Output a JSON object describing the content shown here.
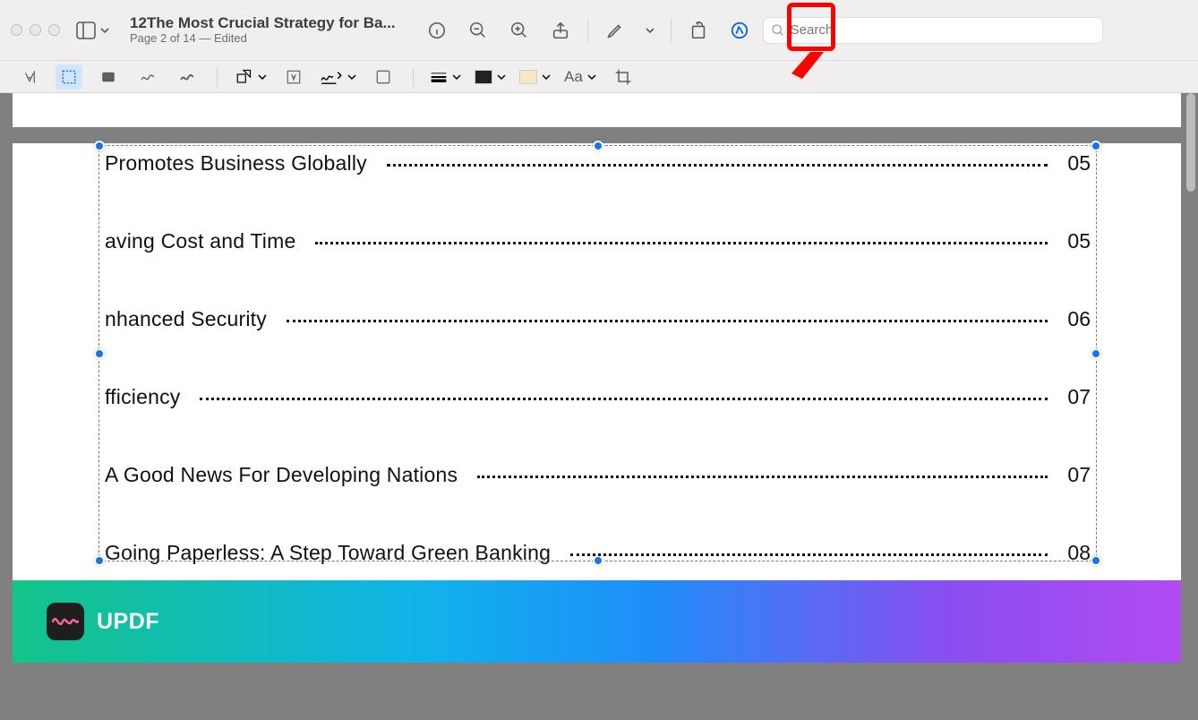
{
  "header": {
    "title": "12The Most Crucial Strategy for Ba...",
    "page_status": "Page 2 of 14 — Edited",
    "search_placeholder": "Search"
  },
  "toc": [
    {
      "title": "Promotes Business Globally",
      "page": "05"
    },
    {
      "title": "aving Cost and Time",
      "page": "05"
    },
    {
      "title": "nhanced Security",
      "page": "06"
    },
    {
      "title": "fficiency",
      "page": "07"
    },
    {
      "title": "A Good News For Developing Nations",
      "page": "07"
    },
    {
      "title": "Going Paperless: A Step Toward Green Banking",
      "page": "08"
    }
  ],
  "banner": {
    "brand": "UPDF"
  }
}
